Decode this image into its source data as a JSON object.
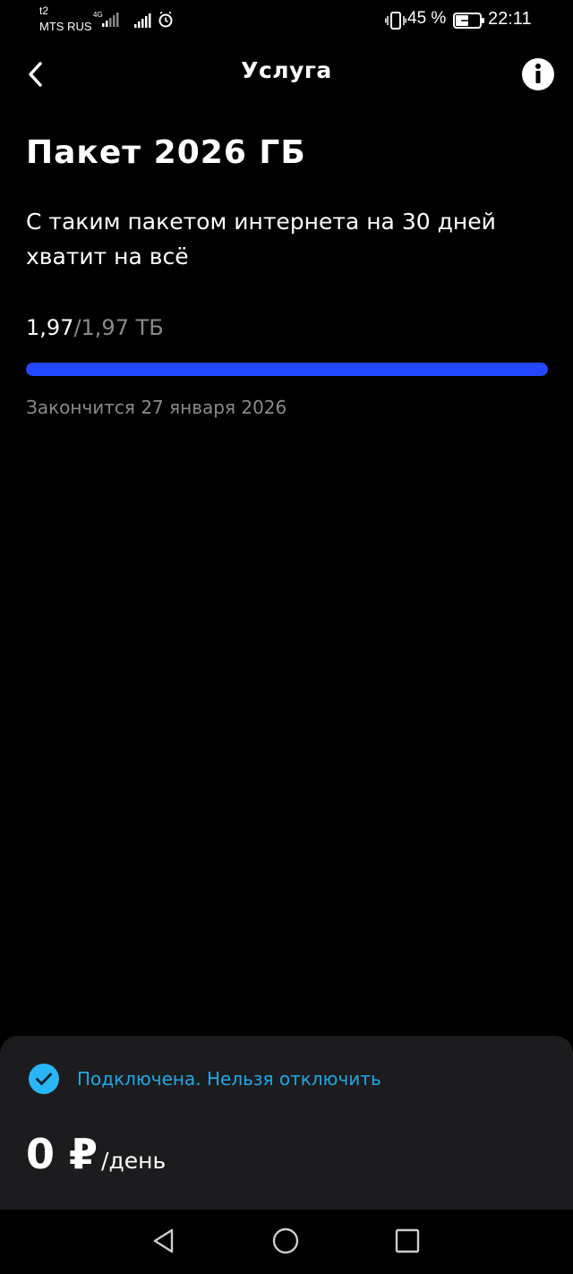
{
  "status_bar": {
    "carrier_line1": "t2",
    "carrier_line2": "MTS RUS",
    "network_type": "4G",
    "battery_percent": "45 %",
    "time": "22:11",
    "icons": [
      "signal-bars-icon",
      "signal-bars-icon",
      "alarm-clock-icon",
      "vibrate-icon",
      "battery-charging-icon"
    ]
  },
  "header": {
    "title": "Услуга",
    "back_icon": "chevron-left-icon",
    "info_icon": "info-icon"
  },
  "package": {
    "title": "Пакет 2026 ГБ",
    "description": "С таким пакетом интернета на 30 дней хватит на всё",
    "usage_used": "1,97",
    "usage_total": "/1,97 ТБ",
    "usage_fraction": 1.0,
    "expires": "Закончится 27 января 2026"
  },
  "bottom_panel": {
    "status_text": "Подключена. Нельзя отключить",
    "price": "0 ₽",
    "price_period": "/день"
  },
  "colors": {
    "background": "#000000",
    "accent_blue": "#2346ff",
    "status_blue": "#22a7e6",
    "muted_text": "#8a8a8a",
    "panel": "#1c1c1e"
  }
}
